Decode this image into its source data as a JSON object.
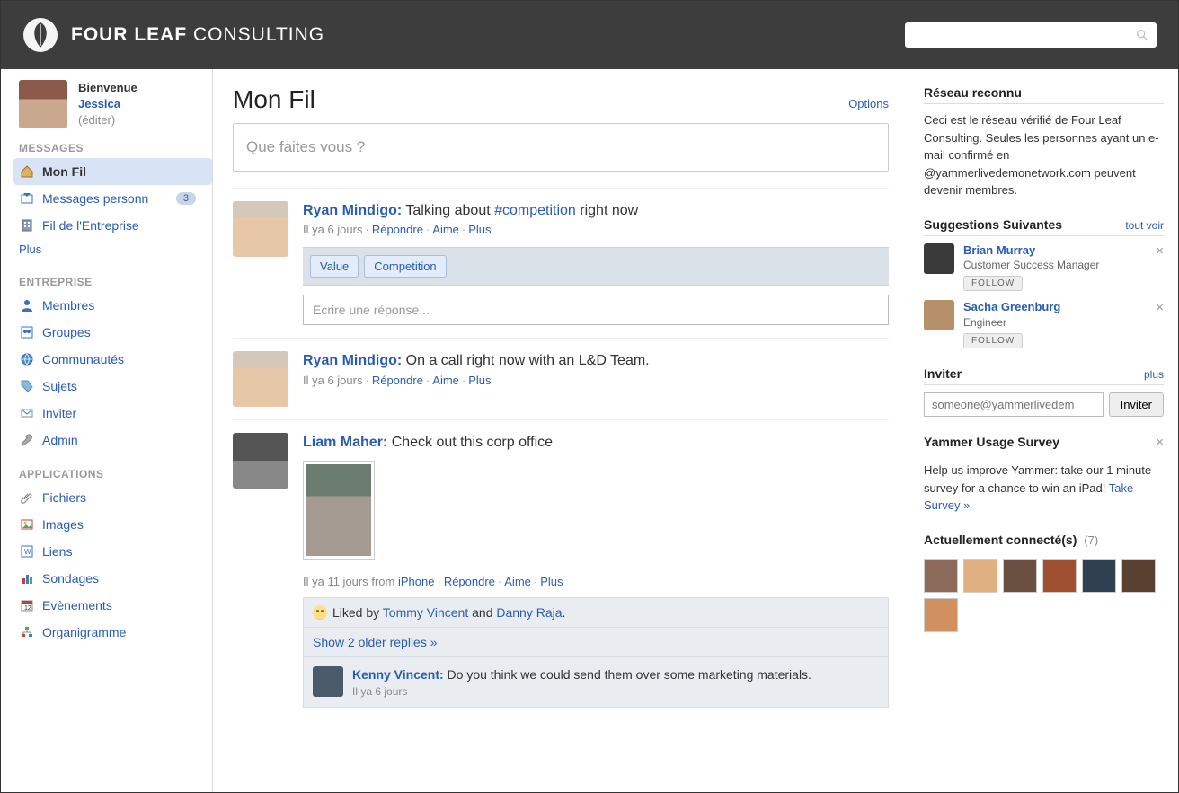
{
  "brand": {
    "bold": "FOUR LEAF",
    "thin": " CONSULTING"
  },
  "search": {
    "placeholder": ""
  },
  "welcome": {
    "hello": "Bienvenue",
    "name": "Jessica",
    "edit": "(éditer)"
  },
  "sidebar": {
    "messages_head": "MESSAGES",
    "plus": "Plus",
    "items_messages": [
      {
        "label": "Mon Fil",
        "active": true
      },
      {
        "label": "Messages personn",
        "badge": "3"
      },
      {
        "label": "Fil de l'Entreprise"
      }
    ],
    "entreprise_head": "ENTREPRISE",
    "items_entreprise": [
      {
        "label": "Membres"
      },
      {
        "label": "Groupes"
      },
      {
        "label": "Communautés"
      },
      {
        "label": "Sujets"
      },
      {
        "label": "Inviter"
      },
      {
        "label": "Admin"
      }
    ],
    "apps_head": "APPLICATIONS",
    "items_apps": [
      {
        "label": "Fichiers"
      },
      {
        "label": "Images"
      },
      {
        "label": "Liens"
      },
      {
        "label": "Sondages"
      },
      {
        "label": "Evènements"
      },
      {
        "label": "Organigramme"
      }
    ]
  },
  "feed": {
    "title": "Mon Fil",
    "options": "Options",
    "composer_placeholder": "Que faites vous ?",
    "meta": {
      "reply": "Répondre",
      "like": "Aime",
      "more": "Plus"
    },
    "reply_placeholder": "Ecrire une réponse...",
    "posts": [
      {
        "author": "Ryan Mindigo:",
        "text_pre": " Talking about ",
        "tag": "#competition",
        "text_post": " right now",
        "time": "Il ya 6 jours",
        "tags": [
          "Value",
          "Competition"
        ]
      },
      {
        "author": "Ryan Mindigo:",
        "text": " On a call right now with an L&D Team.",
        "time": "Il ya 6 jours"
      },
      {
        "author": "Liam Maher:",
        "text": " Check out this corp office",
        "time": "Il ya 11 jours",
        "from_label": " from ",
        "from": "iPhone",
        "liked_prefix": " Liked by ",
        "liker1": "Tommy Vincent",
        "liked_and": " and ",
        "liker2": "Danny  Raja",
        "liked_suffix": ".",
        "show_older": "Show 2 older replies »",
        "reply": {
          "author": "Kenny Vincent:",
          "text": " Do you think we could send them over some marketing materials.",
          "time": "Il ya 6 jours"
        }
      }
    ]
  },
  "right": {
    "known_network": {
      "title": "Réseau reconnu",
      "body": "Ceci est le réseau vérifié de Four Leaf Consulting. Seules les personnes ayant un e-mail confirmé en @yammerlivedemonetwork.com peuvent devenir membres."
    },
    "suggestions": {
      "title": "Suggestions Suivantes",
      "link": "tout voir",
      "items": [
        {
          "name": "Brian Murray",
          "role": "Customer Success Manager",
          "follow": "FOLLOW"
        },
        {
          "name": "Sacha Greenburg",
          "role": "Engineer",
          "follow": "FOLLOW"
        }
      ]
    },
    "invite": {
      "title": "Inviter",
      "link": "plus",
      "placeholder": "someone@yammerlivedem",
      "button": "Inviter"
    },
    "survey": {
      "title": "Yammer Usage Survey",
      "body": "Help us improve Yammer: take our 1 minute survey for a chance to win an iPad! ",
      "link": "Take Survey »"
    },
    "online": {
      "title": "Actuellement connecté(s)",
      "count": "(7)"
    }
  }
}
